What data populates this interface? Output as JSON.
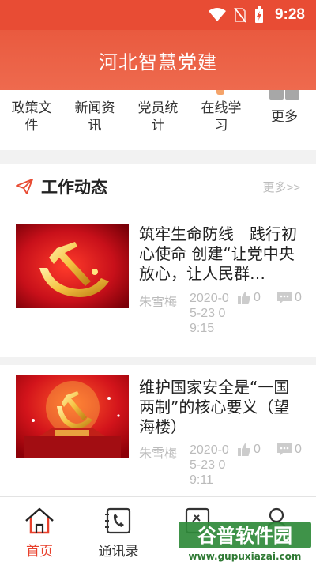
{
  "status_bar": {
    "time": "9:28",
    "icons": [
      "wifi-icon",
      "no-sim-icon",
      "battery-charging-icon"
    ]
  },
  "app_bar": {
    "title": "河北智慧党建"
  },
  "quick_menu": [
    {
      "label": "政策文件",
      "icon": "policy-icon"
    },
    {
      "label": "新闻资讯",
      "icon": "news-icon"
    },
    {
      "label": "党员统计",
      "icon": "stats-icon"
    },
    {
      "label": "在线学习",
      "icon": "learning-icon"
    },
    {
      "label": "更多",
      "icon": "more-grid-icon"
    }
  ],
  "section": {
    "title": "工作动态",
    "more": "更多>>",
    "icon": "send-icon"
  },
  "news": [
    {
      "title": "筑牢生命防线　践行初心使命 创建“让党中央放心，让人民群…",
      "author": "朱雪梅",
      "date": "2020-05-23 09:15",
      "likes": "0",
      "comments": "0"
    },
    {
      "title": "维护国家安全是“一国两制”的核心要义（望海楼）",
      "author": "朱雪梅",
      "date": "2020-05-23 09:11",
      "likes": "0",
      "comments": "0"
    }
  ],
  "bottom_nav": [
    {
      "label": "首页",
      "icon": "home-icon",
      "active": true
    },
    {
      "label": "通讯录",
      "icon": "contacts-icon",
      "active": false
    },
    {
      "label": "",
      "icon": "document-icon",
      "active": false
    },
    {
      "label": "",
      "icon": "user-icon",
      "active": false
    }
  ],
  "watermark": {
    "brand": "谷普软件园",
    "url": "www.gupuxiazai.com"
  },
  "colors": {
    "primary": "#e84c34",
    "accent_text": "#e8412d",
    "muted": "#bbbbbb",
    "flag_red": "#c8101a",
    "emblem_gold": "#f5c242"
  }
}
